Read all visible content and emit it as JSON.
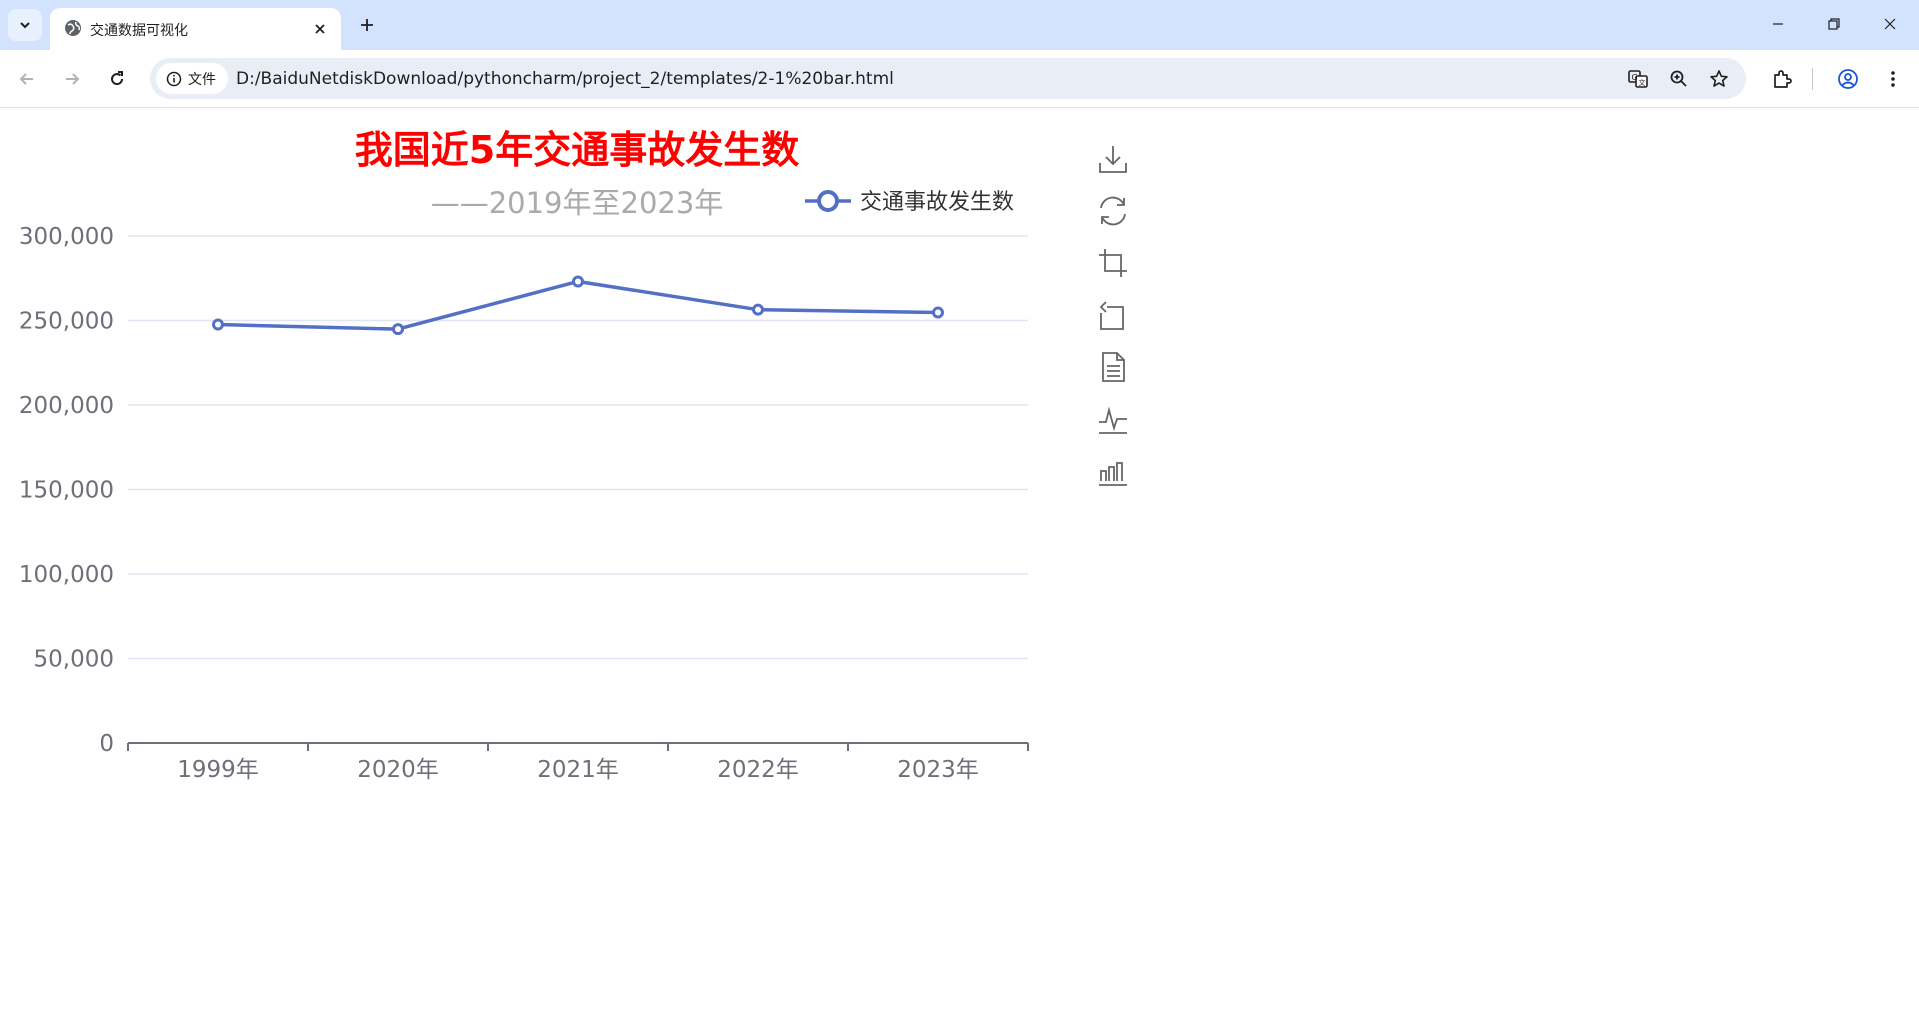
{
  "browser": {
    "tab_title": "交通数据可视化",
    "site_chip_label": "文件",
    "url": "D:/BaiduNetdiskDownload/pythoncharm/project_2/templates/2-1%20bar.html"
  },
  "chart_data": {
    "type": "line",
    "title": "我国近5年交通事故发生数",
    "subtitle": "——2019年至2023年",
    "categories": [
      "1999年",
      "2020年",
      "2021年",
      "2022年",
      "2023年"
    ],
    "series": [
      {
        "name": "交通事故发生数",
        "values": [
          247600,
          244900,
          273100,
          256400,
          254700
        ],
        "color": "#5470c6"
      }
    ],
    "ylim": [
      0,
      300000
    ],
    "yticks": [
      0,
      50000,
      100000,
      150000,
      200000,
      250000,
      300000
    ],
    "grid": true,
    "legend_position": "top-right"
  },
  "toolbox": {
    "items": [
      {
        "name": "save-as-image-icon"
      },
      {
        "name": "restore-icon"
      },
      {
        "name": "data-zoom-icon"
      },
      {
        "name": "data-zoom-back-icon"
      },
      {
        "name": "data-view-icon"
      },
      {
        "name": "switch-to-line-icon"
      },
      {
        "name": "switch-to-bar-icon"
      }
    ]
  }
}
